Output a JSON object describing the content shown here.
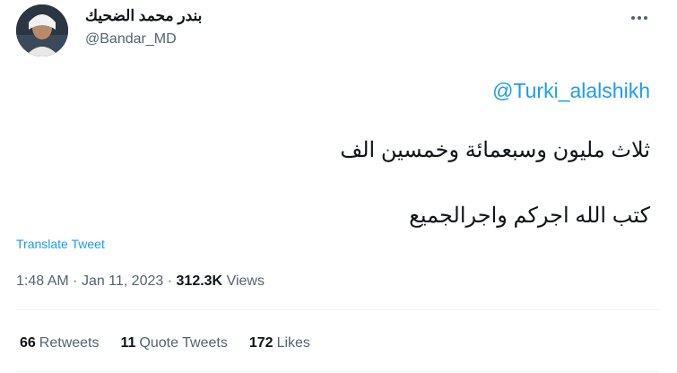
{
  "author": {
    "display_name": "بندر محمد الضحيك",
    "handle": "@Bandar_MD"
  },
  "tweet": {
    "mention": "@Turki_alalshikh",
    "line1": "ثلاث مليون وسبعمائة وخمسين الف",
    "line2": "كتب الله اجركم واجرالجميع"
  },
  "translate_label": "Translate Tweet",
  "meta": {
    "time": "1:48 AM",
    "separator": "·",
    "date": "Jan 11, 2023",
    "views_count": "312.3K",
    "views_label": "Views"
  },
  "stats": {
    "retweets_count": "66",
    "retweets_label": "Retweets",
    "quotes_count": "11",
    "quotes_label": "Quote Tweets",
    "likes_count": "172",
    "likes_label": "Likes"
  },
  "icons": {
    "more": "more-horizontal-icon"
  }
}
